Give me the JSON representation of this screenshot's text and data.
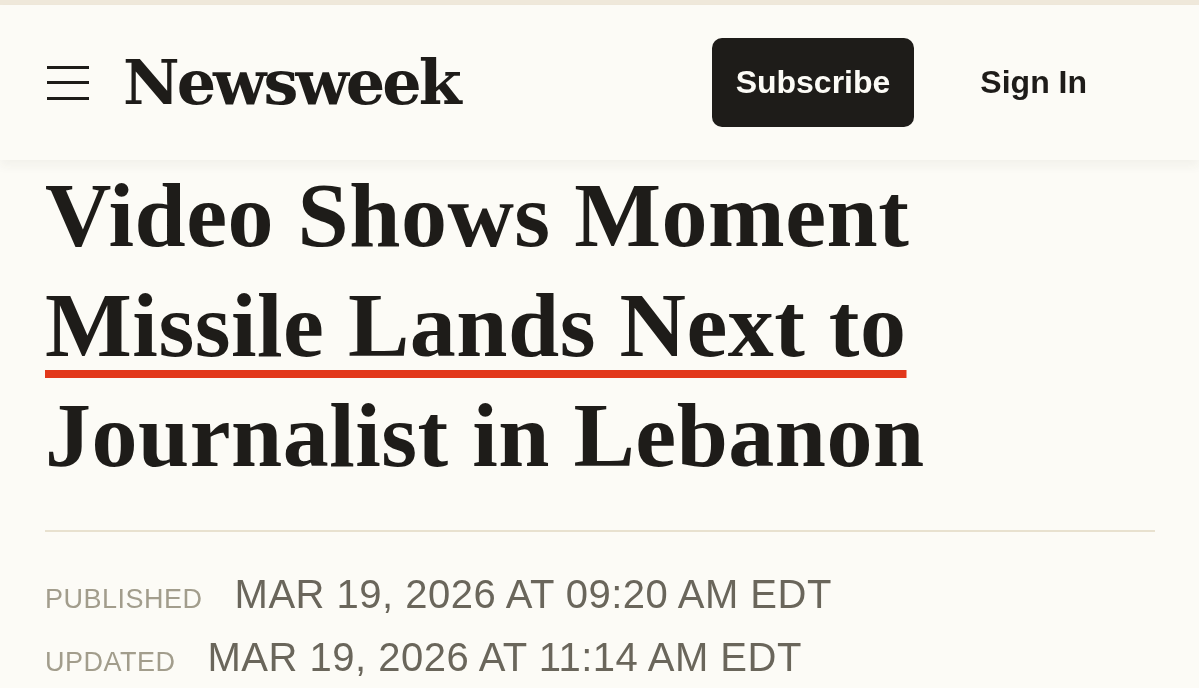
{
  "header": {
    "logo": "Newsweek",
    "subscribe_button": "Subscribe",
    "sign_in_link": "Sign In"
  },
  "headline": {
    "lines": [
      {
        "text": "Video Shows Moment",
        "underlined": false
      },
      {
        "text": "Missile Lands Next to",
        "underlined": true
      },
      {
        "text": "Journalist in Lebanon",
        "underlined": false
      }
    ]
  },
  "dates": [
    {
      "label": "PUBLISHED",
      "value": "MAR 19, 2026 AT 09:20 AM EDT"
    },
    {
      "label": "UPDATED",
      "value": "MAR 19, 2026 AT 11:14 AM EDT"
    }
  ]
}
